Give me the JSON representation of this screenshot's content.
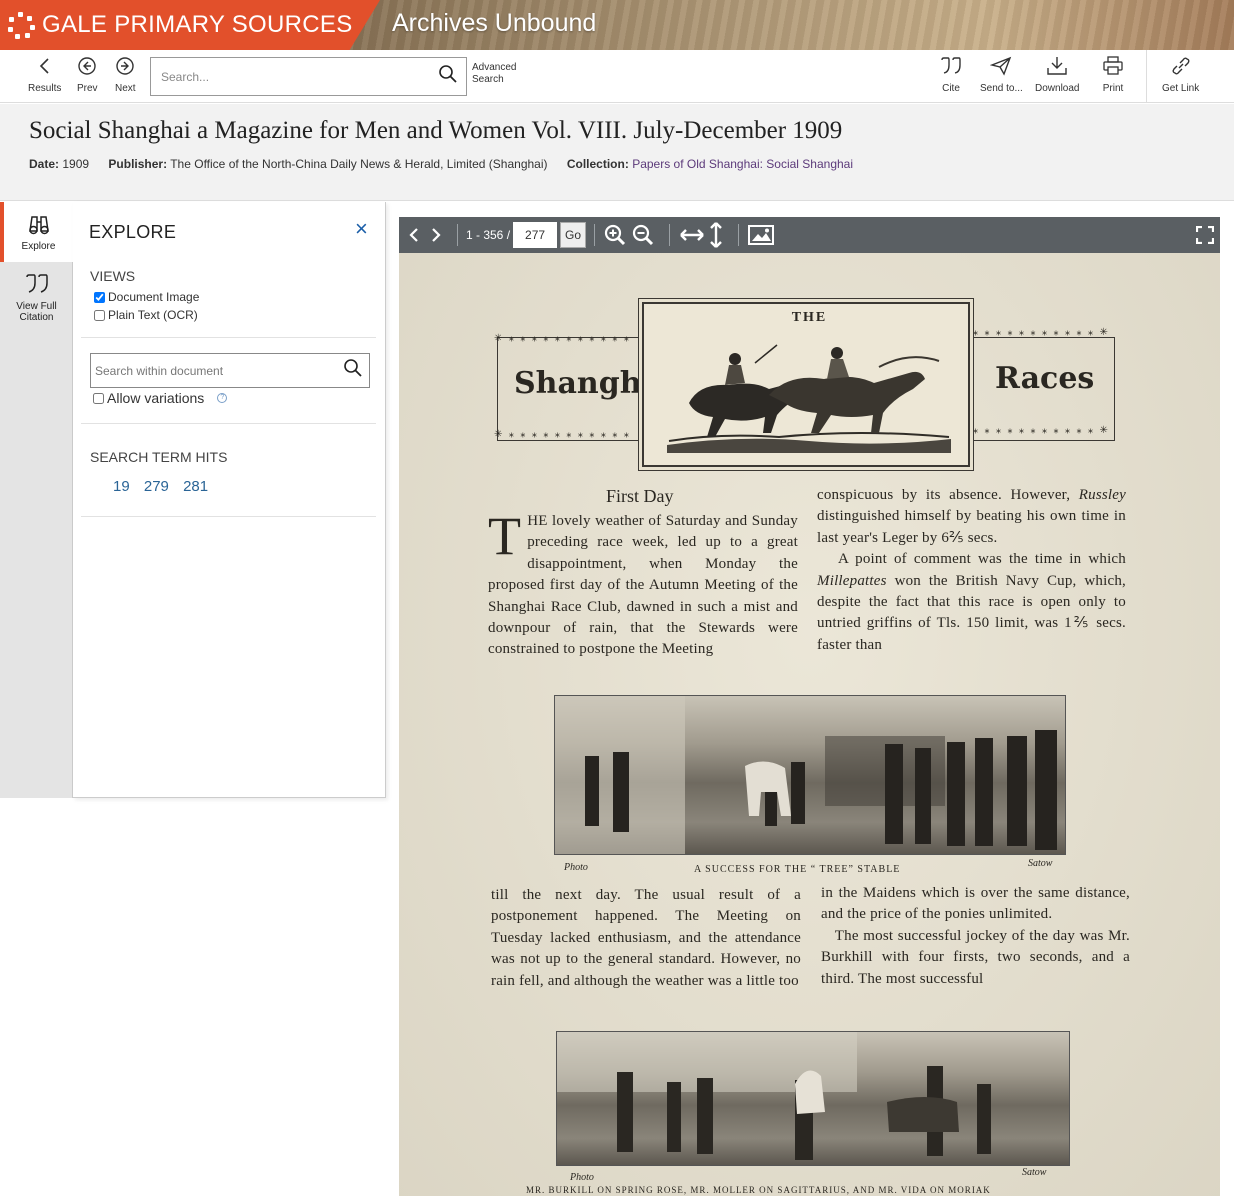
{
  "banner": {
    "brand": "GALE PRIMARY SOURCES",
    "product": "Archives Unbound"
  },
  "toolbar": {
    "results": "Results",
    "prev": "Prev",
    "next": "Next",
    "search_placeholder": "Search...",
    "advanced_line1": "Advanced",
    "advanced_line2": "Search",
    "cite": "Cite",
    "send": "Send to...",
    "download": "Download",
    "print": "Print",
    "get_link": "Get Link"
  },
  "document": {
    "title": "Social Shanghai a Magazine for Men and Women Vol. VIII. July-December 1909",
    "date_label": "Date:",
    "date": "1909",
    "publisher_label": "Publisher:",
    "publisher": "The Office of the North-China Daily News & Herald, Limited (Shanghai)",
    "collection_label": "Collection:",
    "collection": "Papers of Old Shanghai: Social Shanghai"
  },
  "rail": {
    "explore": "Explore",
    "citation_line1": "View Full",
    "citation_line2": "Citation"
  },
  "explore": {
    "title": "EXPLORE",
    "views_heading": "VIEWS",
    "document_image": "Document Image",
    "plain_text": "Plain Text (OCR)",
    "search_placeholder": "Search within document",
    "allow_variations": "Allow variations",
    "hits_heading": "SEARCH TERM HITS",
    "hits": [
      "19",
      "279",
      "281"
    ]
  },
  "viewer": {
    "range": "1 - 356 /",
    "page": "277",
    "go": "Go"
  },
  "scan": {
    "header_the": "THE",
    "header_left": "Shanghai",
    "header_right": "Races",
    "first_day": "First Day",
    "drop_cap": "T",
    "col1_top": "HE lovely weather of Saturday and Sunday preceding race week, led up to a great disappointment, when Monday the proposed first day of the Autumn Meeting of the Shanghai Race Club, dawned in such a mist and downpour of rain, that the Stewards were constrained to postpone the Meeting",
    "col2_top_a": "conspicuous by its absence. However,",
    "col2_top_b": "Russley",
    "col2_top_c": "distinguished himself by beating his own time in last year's Leger by 6⅖ secs.",
    "col2_top_d": "A point of comment was the time in which",
    "col2_top_e": "Millepattes",
    "col2_top_f": "won the British Navy Cup, which, despite the fact that this race is open only to untried griffins of Tls. 150 limit, was 1⅖ secs. faster than",
    "cap1_photo": "Photo",
    "cap1_text": "A SUCCESS FOR THE “ TREE” STABLE",
    "cap1_credit": "Satow",
    "col1_mid": "till the next day. The usual result of a postponement happened. The Meeting on Tuesday lacked enthusiasm, and the attendance was not up to the general standard. However, no rain fell, and although the weather was a little too",
    "col2_mid_a": "in the Maidens which is over the same distance, and the price of the ponies unlimited.",
    "col2_mid_b": "The most successful jockey of the day was Mr. Burkhill with four firsts, two seconds, and a third. The most successful",
    "cap2_photo": "Photo",
    "cap2_credit": "Satow",
    "cap2_text": "MR. BURKILL ON SPRING ROSE, MR. MOLLER ON SAGITTARIUS, AND MR. VIDA ON MORIAK"
  }
}
